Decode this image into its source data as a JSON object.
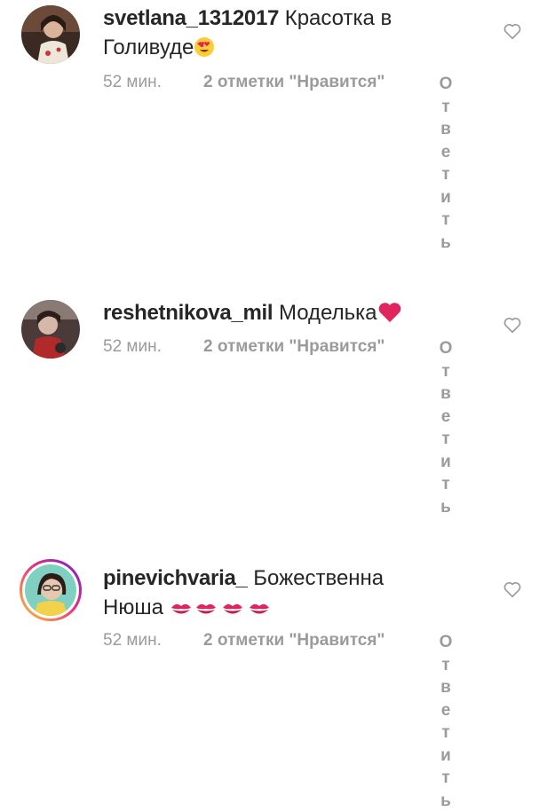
{
  "comments": [
    {
      "username": "svetlana_1312017",
      "text": "Красотка в Голивуде",
      "emoji": "heart-eyes-emoji",
      "time": "52 мин.",
      "likes": "2 отметки \"Нравится\"",
      "reply_label": "Ответить"
    },
    {
      "username": "reshetnikova_mil",
      "text": "Моделька",
      "emoji": "red-heart-emoji",
      "time": "52 мин.",
      "likes": "2 отметки \"Нравится\"",
      "reply_label": "Ответить"
    },
    {
      "username": "pinevichvaria_",
      "text": "Божественна Нюша",
      "emoji": "kiss-mark-emoji x4",
      "time": "52 мин.",
      "likes": "2 отметки \"Нравится\"",
      "reply_label": "Ответить"
    }
  ],
  "colors": {
    "text": "#262626",
    "meta": "#9b9b9b",
    "emoji_red": "#e0245e"
  }
}
